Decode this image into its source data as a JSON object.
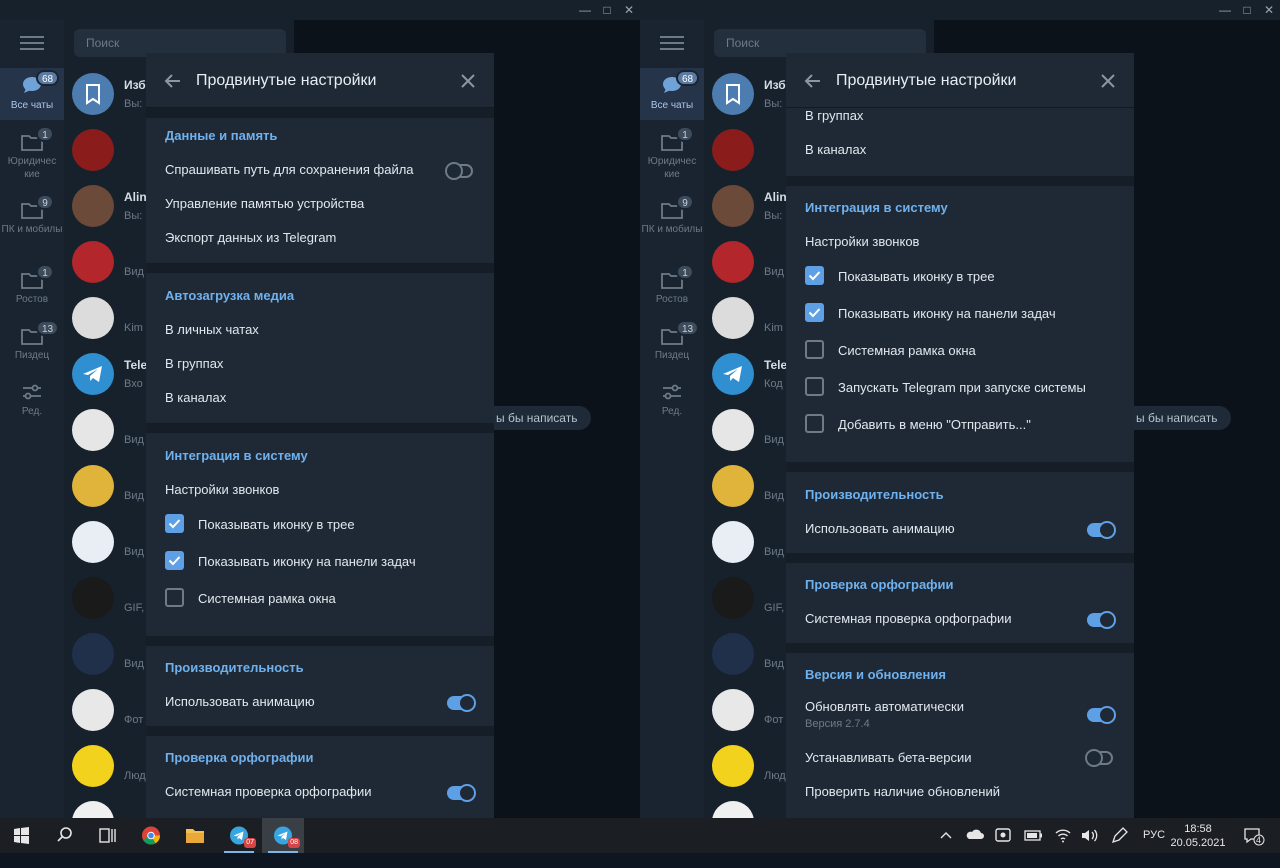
{
  "windows": [
    {
      "id": "left",
      "search_placeholder": "Поиск",
      "folders": [
        {
          "label": "Все чаты",
          "badge": "68",
          "active": true
        },
        {
          "label": "Юридичес кие",
          "badge": "1"
        },
        {
          "label": "ПК и мобилы",
          "badge": "9"
        },
        {
          "label": "Ростов",
          "badge": "1"
        },
        {
          "label": "Пиздец",
          "badge": "13"
        },
        {
          "label": "Ред."
        }
      ],
      "chats": [
        {
          "name": "Изб",
          "preview": "Вы:"
        },
        {
          "name": "",
          "preview": ""
        },
        {
          "name": "Alin",
          "preview": "Вы:"
        },
        {
          "name": "",
          "preview": "Вид"
        },
        {
          "name": "",
          "preview": "Kim"
        },
        {
          "name": "Tele",
          "preview": "Вхо"
        },
        {
          "name": "",
          "preview": "Вид"
        },
        {
          "name": "",
          "preview": "Вид"
        },
        {
          "name": "",
          "preview": "Вид"
        },
        {
          "name": "",
          "preview": "GIF,"
        },
        {
          "name": "",
          "preview": "Вид"
        },
        {
          "name": "",
          "preview": "Фот"
        },
        {
          "name": "",
          "preview": "Люд"
        },
        {
          "name": "",
          "preview": ""
        }
      ],
      "hint": "ы бы написать",
      "dialog": {
        "title": "Продвинутые настройки",
        "sections": [
          {
            "title": "Данные и память",
            "items": [
              "Спрашивать путь для сохранения файла",
              "Управление памятью устройства",
              "Экспорт данных из Telegram"
            ]
          },
          {
            "title": "Автозагрузка медиа",
            "items": [
              "В личных чатах",
              "В группах",
              "В каналах"
            ]
          },
          {
            "title": "Интеграция в систему",
            "items": [
              "Настройки звонков",
              "Показывать иконку в трее",
              "Показывать иконку на панели задач",
              "Системная рамка окна"
            ]
          },
          {
            "title": "Производительность",
            "items": [
              "Использовать анимацию"
            ]
          },
          {
            "title": "Проверка орфографии",
            "items": [
              "Системная проверка орфографии"
            ]
          }
        ]
      }
    },
    {
      "id": "right",
      "search_placeholder": "Поиск",
      "folders": [
        {
          "label": "Все чаты",
          "badge": "68",
          "active": true
        },
        {
          "label": "Юридичес кие",
          "badge": "1"
        },
        {
          "label": "ПК и мобилы",
          "badge": "9"
        },
        {
          "label": "Ростов",
          "badge": "1"
        },
        {
          "label": "Пиздец",
          "badge": "13"
        },
        {
          "label": "Ред."
        }
      ],
      "chats": [
        {
          "name": "Изб",
          "preview": "Вы:"
        },
        {
          "name": "",
          "preview": ""
        },
        {
          "name": "Alin",
          "preview": "Вы:"
        },
        {
          "name": "",
          "preview": "Вид"
        },
        {
          "name": "",
          "preview": "Kim"
        },
        {
          "name": "Tele",
          "preview": "Код"
        },
        {
          "name": "",
          "preview": "Вид"
        },
        {
          "name": "",
          "preview": "Вид"
        },
        {
          "name": "",
          "preview": "Вид"
        },
        {
          "name": "",
          "preview": "GIF,"
        },
        {
          "name": "",
          "preview": "Вид"
        },
        {
          "name": "",
          "preview": "Фот"
        },
        {
          "name": "",
          "preview": "Люд"
        },
        {
          "name": "",
          "preview": ""
        }
      ],
      "hint": "ы бы написать",
      "dialog": {
        "title": "Продвинутые настройки",
        "sections": [
          {
            "title": "",
            "items": [
              "В группах",
              "В каналах"
            ]
          },
          {
            "title": "Интеграция в систему",
            "items": [
              "Настройки звонков",
              "Показывать иконку в трее",
              "Показывать иконку на панели задач",
              "Системная рамка окна",
              "Запускать Telegram при запуске системы",
              "Добавить в меню \"Отправить...\""
            ]
          },
          {
            "title": "Производительность",
            "items": [
              "Использовать анимацию"
            ]
          },
          {
            "title": "Проверка орфографии",
            "items": [
              "Системная проверка орфографии"
            ]
          },
          {
            "title": "Версия и обновления",
            "items": [
              "Обновлять автоматически",
              "Устанавливать бета-версии",
              "Проверить наличие обновлений"
            ],
            "version": "Версия 2.7.4"
          }
        ]
      }
    }
  ],
  "taskbar": {
    "tg1_badge": "07",
    "tg2_badge": "08",
    "lang": "РУС",
    "time": "18:58",
    "date": "20.05.2021",
    "notifications": "4"
  },
  "colors": {
    "accent": "#5ea0e6",
    "bg": "#17212b",
    "dialog": "#1f2935",
    "section_title": "#6fb1ee"
  }
}
